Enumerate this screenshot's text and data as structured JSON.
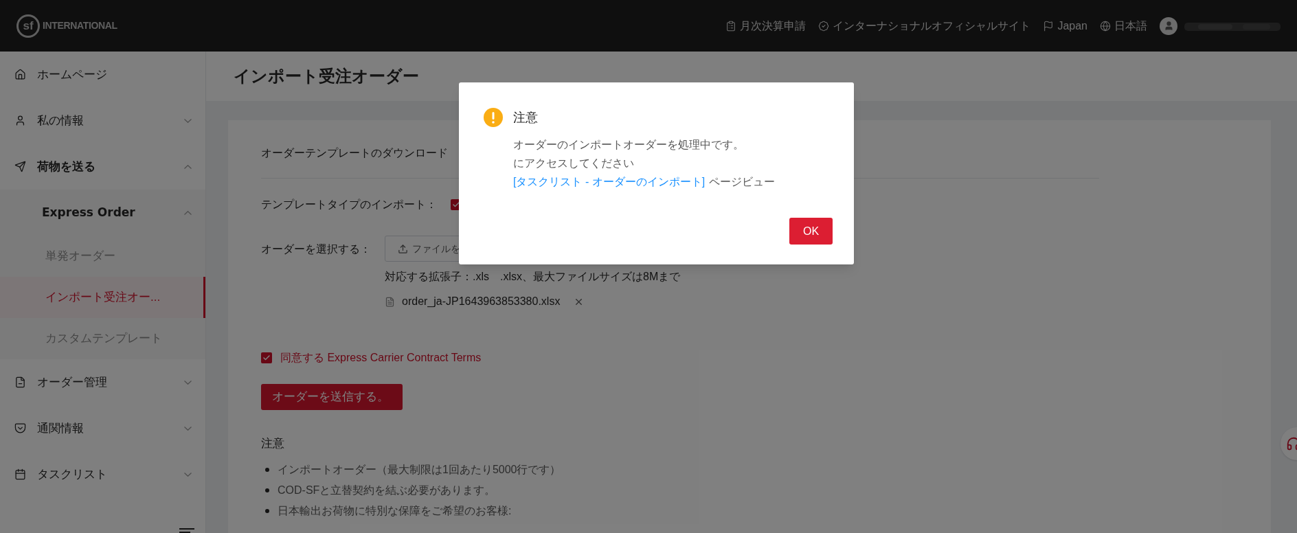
{
  "header": {
    "logo": {
      "mark": "sf",
      "name": "INTERNATIONAL"
    },
    "links": [
      {
        "kind": "billing",
        "label": "月次決算申請"
      },
      {
        "kind": "site",
        "label": "インターナショナルオフィシャルサイト"
      },
      {
        "kind": "region",
        "label": "Japan"
      },
      {
        "kind": "language",
        "label": "日本語"
      }
    ]
  },
  "sidebar": {
    "items": [
      {
        "kind": "home",
        "label": "ホームページ",
        "selected": false
      },
      {
        "kind": "user",
        "label": "私の情報",
        "selected": false,
        "expanded": false
      },
      {
        "kind": "send",
        "label": "荷物を送る",
        "selected": false,
        "expanded": true,
        "children": [
          {
            "label": "Express Order",
            "expanded": true,
            "children": [
              {
                "label": "単発オーダー",
                "selected": false
              },
              {
                "label": "インポート受注オー...",
                "selected": true
              },
              {
                "label": "カスタムテンプレート",
                "selected": false
              }
            ]
          }
        ]
      },
      {
        "kind": "orders",
        "label": "オーダー管理",
        "selected": false,
        "expanded": false
      },
      {
        "kind": "customs",
        "label": "通関情報",
        "selected": false,
        "expanded": false
      },
      {
        "kind": "tasks",
        "label": "タスクリスト",
        "selected": false,
        "expanded": false
      }
    ]
  },
  "page_title": "インポート受注オーダー",
  "form": {
    "template_download": "オーダーテンプレートのダウンロード",
    "template_type": {
      "label": "テンプレートタイプのインポート：",
      "checked": true
    },
    "select_order": {
      "label": "オーダーを選択する：",
      "button": "ファイルを"
    },
    "hint": "対応する拡張子：.xls　.xlsx、最大ファイルサイズは8Mまで",
    "file": {
      "name": "order_ja-JP1643963853380.xlsx"
    },
    "agree": {
      "label": "同意する Express Carrier Contract Terms",
      "checked": true
    },
    "submit": "オーダーを送信する。",
    "notes": {
      "title": "注意",
      "items": [
        "インポートオーダー（最大制限は1回あたり5000行です）",
        "COD-SFと立替契約を結ぶ必要があります。",
        "日本輸出お荷物に特別な保障をご希望のお客様:"
      ]
    }
  },
  "modal": {
    "title": "注意",
    "message": "オーダーのインポートオーダーを処理中です。",
    "access": {
      "before": "にアクセスしてください",
      "link": "[タスクリスト - オーダーのインポート]",
      "after": "ページビュー"
    },
    "ok": "OK"
  }
}
